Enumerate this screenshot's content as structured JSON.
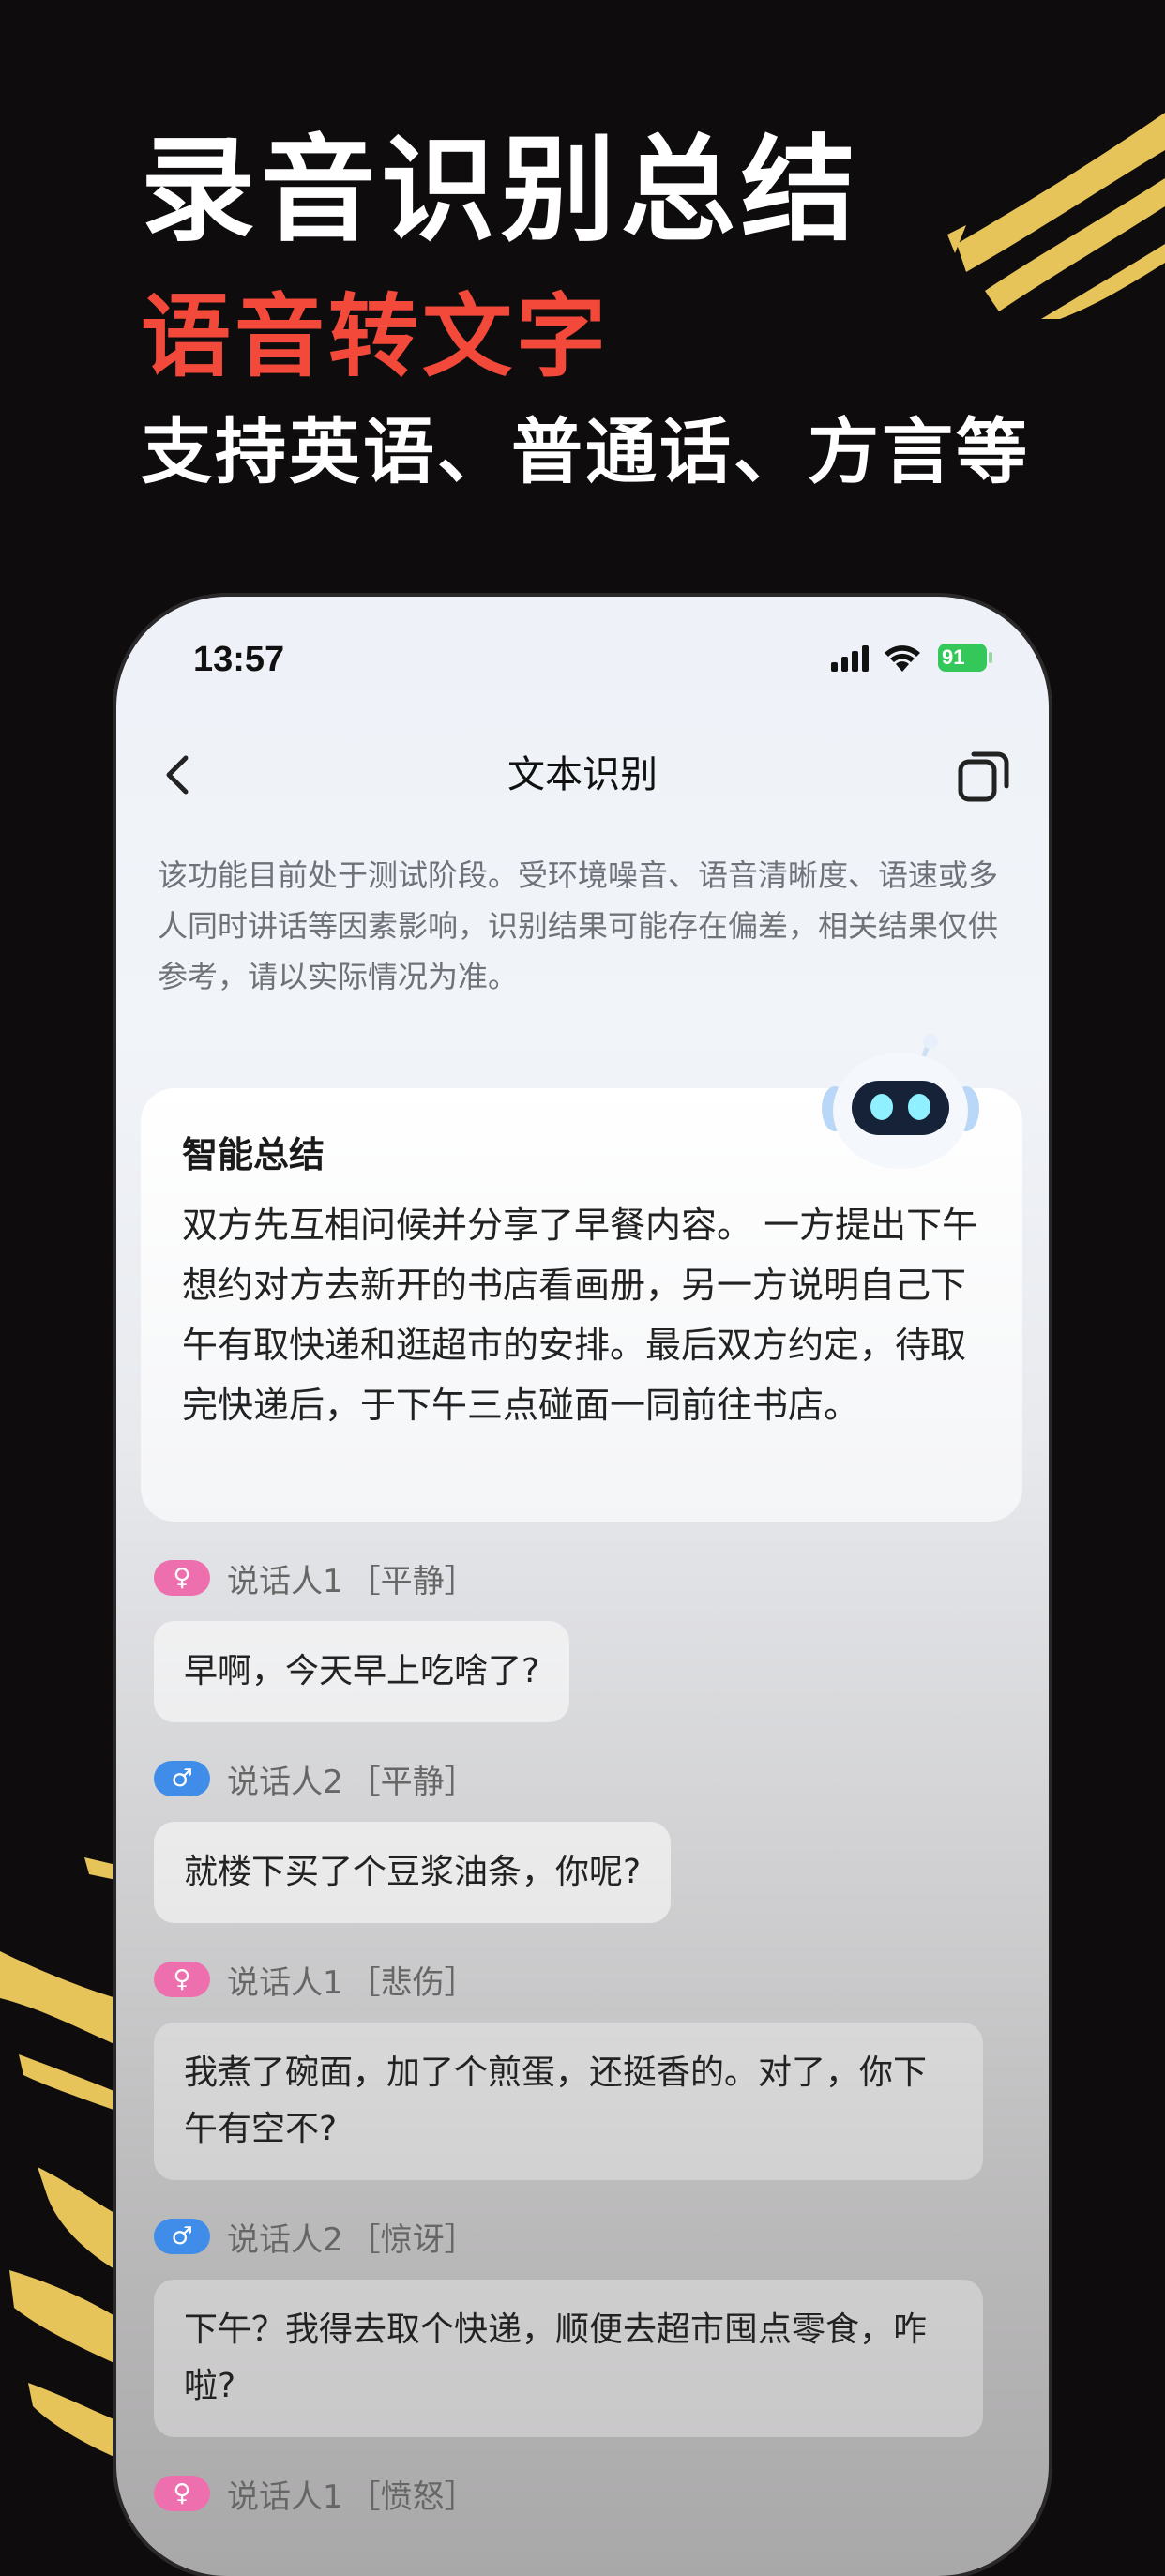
{
  "promo": {
    "headline": "录音识别总结",
    "subheadline_red": "语音转文字",
    "subheadline_white": "支持英语、普通话、方言等"
  },
  "status_bar": {
    "time": "13:57",
    "battery": "91"
  },
  "nav": {
    "title": "文本识别"
  },
  "disclaimer": "该功能目前处于测试阶段。受环境噪音、语音清晰度、语速或多人同时讲话等因素影响，识别结果可能存在偏差，相关结果仅供参考，请以实际情况为准。",
  "summary": {
    "title": "智能总结",
    "body": "双方先互相问候并分享了早餐内容。 一方提出下午想约对方去新开的书店看画册，另一方说明自己下午有取快递和逛超市的安排。最后双方约定，待取完快递后，于下午三点碰面一同前往书店。"
  },
  "conversation": [
    {
      "speaker": "说话人1",
      "emotion": "［平静］",
      "gender_icon": "female-icon",
      "text": "早啊，今天早上吃啥了?"
    },
    {
      "speaker": "说话人2",
      "emotion": "［平静］",
      "gender_icon": "male-icon",
      "text": "就楼下买了个豆浆油条，你呢?"
    },
    {
      "speaker": "说话人1",
      "emotion": "［悲伤］",
      "gender_icon": "female-icon",
      "text": "我煮了碗面，加了个煎蛋，还挺香的。对了，你下午有空不?"
    },
    {
      "speaker": "说话人2",
      "emotion": "［惊讶］",
      "gender_icon": "male-icon",
      "text": "下午？我得去取个快递，顺便去超市囤点零食，咋啦?"
    },
    {
      "speaker": "说话人1",
      "emotion": "［愤怒］",
      "gender_icon": "female-icon",
      "text": ""
    }
  ],
  "colors": {
    "accent_red": "#f2493a",
    "female_badge": "#ee6fae",
    "male_badge": "#3f8de8",
    "brush_gold": "#e7c45a",
    "battery_green": "#34c759"
  }
}
